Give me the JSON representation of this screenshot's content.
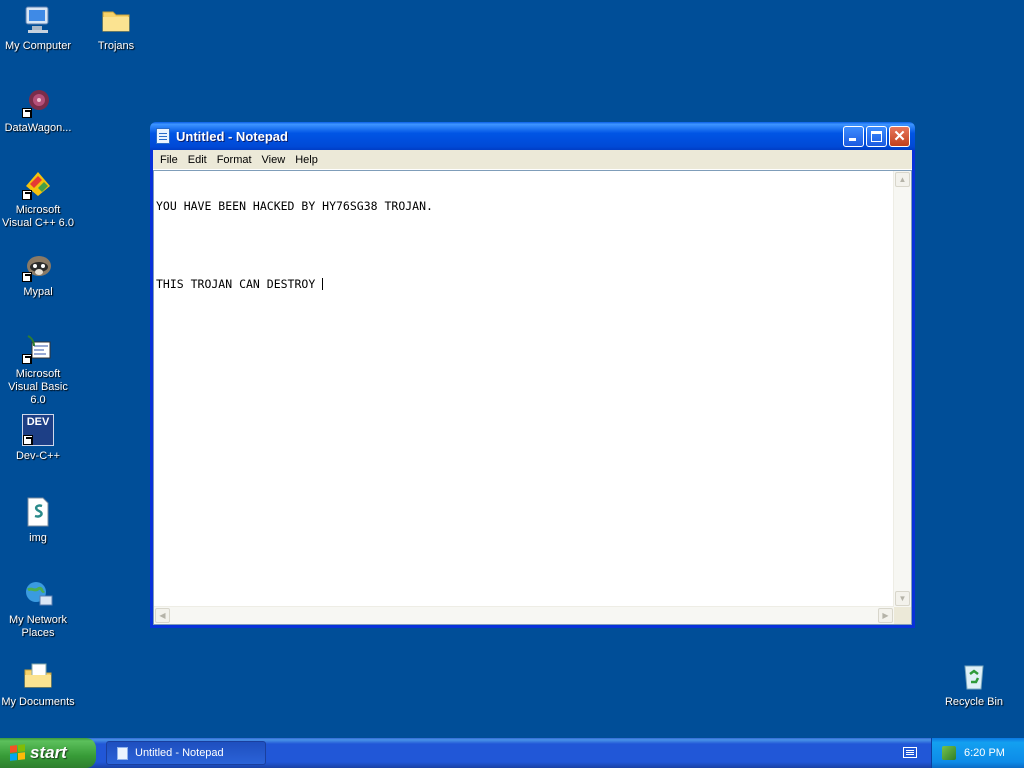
{
  "desktop": {
    "icons": [
      {
        "label": "My Computer",
        "icon": "my-computer-icon"
      },
      {
        "label": "Trojans",
        "icon": "folder-icon"
      },
      {
        "label": "DataWagon...",
        "icon": "datawagon-icon"
      },
      {
        "label": "Microsoft Visual C++ 6.0",
        "icon": "visual-cpp-icon"
      },
      {
        "label": "Mypal",
        "icon": "mypal-icon"
      },
      {
        "label": "Microsoft Visual Basic 6.0",
        "icon": "visual-basic-icon"
      },
      {
        "label": "Dev-C++",
        "icon": "dev-cpp-icon"
      },
      {
        "label": "img",
        "icon": "img-file-icon"
      },
      {
        "label": "My Network Places",
        "icon": "network-places-icon"
      },
      {
        "label": "My Documents",
        "icon": "my-documents-icon"
      },
      {
        "label": "Recycle Bin",
        "icon": "recycle-bin-icon"
      }
    ],
    "dev_badge": "DEV"
  },
  "notepad": {
    "title": "Untitled - Notepad",
    "menu": [
      "File",
      "Edit",
      "Format",
      "View",
      "Help"
    ],
    "lines": [
      "YOU HAVE BEEN HACKED BY HY76SG38 TROJAN.",
      "",
      "THIS TROJAN CAN DESTROY "
    ]
  },
  "taskbar": {
    "start_label": "start",
    "task_button": "Untitled - Notepad",
    "clock": "6:20 PM"
  },
  "colors": {
    "desktop_bg": "#004e98",
    "titlebar": "#0055e5",
    "start_green": "#379b37"
  }
}
